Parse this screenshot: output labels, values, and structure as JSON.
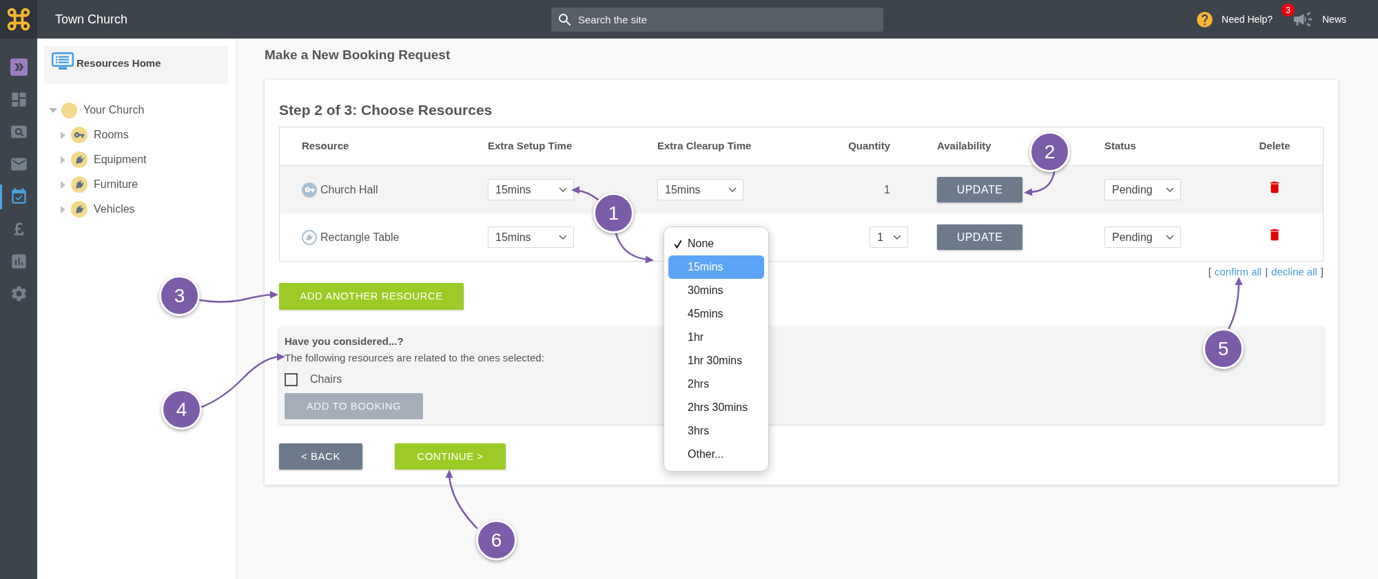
{
  "top_bar": {
    "site_name": "Town Church",
    "search": {
      "placeholder": "Search the site"
    },
    "help": {
      "label": "Need Help?"
    },
    "news": {
      "label": "News",
      "badge": "3"
    }
  },
  "nav_rail": {
    "items": [
      {
        "kind": "expand",
        "selected": false
      },
      {
        "kind": "dashboard",
        "selected": false
      },
      {
        "kind": "search",
        "selected": false
      },
      {
        "kind": "mail",
        "selected": false
      },
      {
        "kind": "calendar",
        "selected": true
      },
      {
        "kind": "finance",
        "selected": false
      },
      {
        "kind": "reports",
        "selected": false
      },
      {
        "kind": "settings",
        "selected": false
      }
    ]
  },
  "sidebar": {
    "home_link": "Resources Home",
    "tree": [
      {
        "label": "Your Church",
        "kind": "site",
        "expanded": true,
        "children": [
          {
            "label": "Rooms",
            "kind": "room",
            "expanded": false
          },
          {
            "label": "Equipment",
            "kind": "equipment",
            "expanded": false
          },
          {
            "label": "Furniture",
            "kind": "equipment",
            "expanded": false
          },
          {
            "label": "Vehicles",
            "kind": "equipment",
            "expanded": false
          }
        ]
      }
    ]
  },
  "page": {
    "title": "Make a New Booking Request",
    "step_title": "Step 2 of 3: Choose Resources"
  },
  "table": {
    "columns": [
      "Resource",
      "Extra Setup Time",
      "Extra Clearup Time",
      "Quantity",
      "Availability",
      "Status",
      "Delete"
    ],
    "rows": [
      {
        "resource": "Church Hall",
        "kind": "room",
        "setup_time": "15mins",
        "clearup_time": "15mins",
        "quantity": {
          "kind": "text",
          "value": "1"
        },
        "availability": "UPDATE",
        "status": "Pending"
      },
      {
        "resource": "Rectangle Table",
        "kind": "equipment",
        "setup_time": "15mins",
        "clearup_menu": {
          "options": [
            {
              "label": "None",
              "selected": true,
              "highlighted": false
            },
            {
              "label": "15mins",
              "selected": false,
              "highlighted": true
            },
            {
              "label": "30mins",
              "selected": false,
              "highlighted": false
            },
            {
              "label": "45mins",
              "selected": false,
              "highlighted": false
            },
            {
              "label": "1hr",
              "selected": false,
              "highlighted": false
            },
            {
              "label": "1hr 30mins",
              "selected": false,
              "highlighted": false
            },
            {
              "label": "2hrs",
              "selected": false,
              "highlighted": false
            },
            {
              "label": "2hrs 30mins",
              "selected": false,
              "highlighted": false
            },
            {
              "label": "3hrs",
              "selected": false,
              "highlighted": false
            },
            {
              "label": "Other...",
              "selected": false,
              "highlighted": false
            }
          ]
        },
        "quantity": {
          "kind": "select",
          "value": "1"
        },
        "availability": "UPDATE",
        "status": "Pending"
      }
    ]
  },
  "bulk_actions": {
    "open_bracket": "[",
    "confirm": "confirm all",
    "separator": "|",
    "decline": "decline all",
    "close_bracket": "]"
  },
  "add_resource_button": "ADD ANOTHER RESOURCE",
  "suggestions": {
    "title": "Have you considered...?",
    "description": "The following resources are related to the ones selected:",
    "items": [
      {
        "label": "Chairs",
        "checked": false
      }
    ],
    "button": {
      "label": "ADD TO BOOKING",
      "disabled": true
    }
  },
  "navigation": {
    "back": "< BACK",
    "continue": "CONTINUE >"
  },
  "annotations": [
    {
      "number": "1"
    },
    {
      "number": "2"
    },
    {
      "number": "3"
    },
    {
      "number": "4"
    },
    {
      "number": "5"
    },
    {
      "number": "6"
    }
  ]
}
